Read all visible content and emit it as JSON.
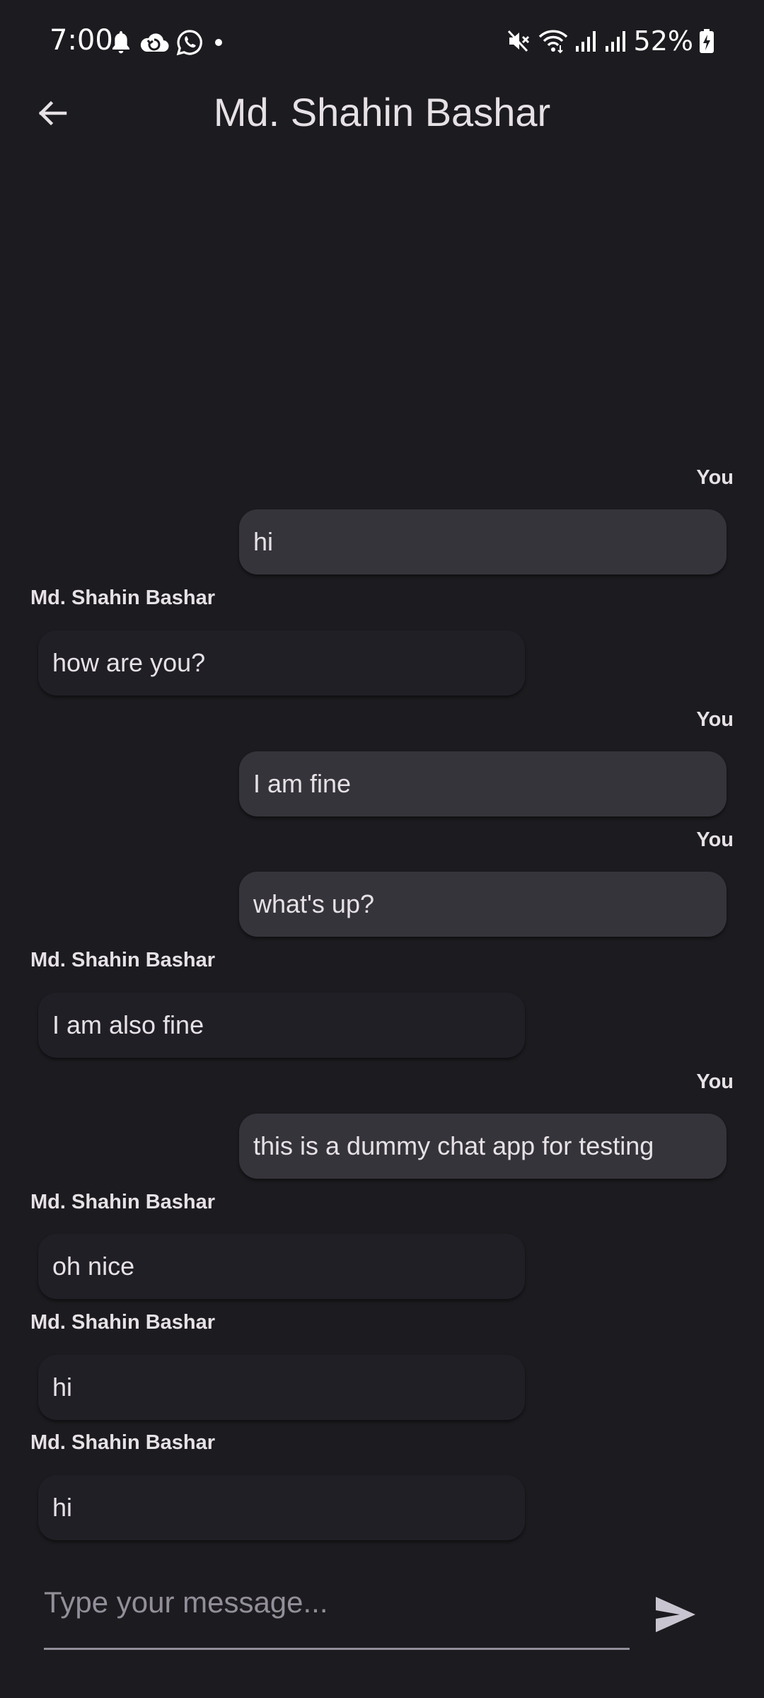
{
  "status_bar": {
    "time": "7:00",
    "battery": "52%",
    "left_icons": [
      "bell-icon",
      "cloud-sync-icon",
      "whatsapp-icon",
      "dot-icon"
    ],
    "right_icons": [
      "mute-icon",
      "wifi-icon",
      "signal-icon",
      "signal-icon",
      "battery-icon"
    ]
  },
  "app_bar": {
    "title": "Md. Shahin Bashar",
    "back_icon": "arrow-back-icon"
  },
  "messages": [
    {
      "sender": "You",
      "text": "hi",
      "mine": true
    },
    {
      "sender": "Md. Shahin Bashar",
      "text": "how are you?",
      "mine": false
    },
    {
      "sender": "You",
      "text": "I am fine",
      "mine": true
    },
    {
      "sender": "You",
      "text": "what's up?",
      "mine": true
    },
    {
      "sender": "Md. Shahin Bashar",
      "text": "I am also fine",
      "mine": false
    },
    {
      "sender": "You",
      "text": "this is a dummy chat app for testing",
      "mine": true
    },
    {
      "sender": "Md. Shahin Bashar",
      "text": "oh nice",
      "mine": false
    },
    {
      "sender": "Md. Shahin Bashar",
      "text": "hi",
      "mine": false
    },
    {
      "sender": "Md. Shahin Bashar",
      "text": "hi",
      "mine": false
    }
  ],
  "composer": {
    "placeholder": "Type your message...",
    "value": "",
    "send_icon": "send-icon"
  },
  "colors": {
    "background": "#1c1b1f",
    "my_bubble": "#36343b",
    "their_bubble": "#211f26",
    "text": "#e6e1e5",
    "muted": "#938f99"
  }
}
